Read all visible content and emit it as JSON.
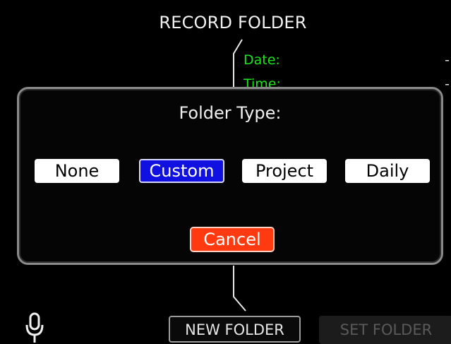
{
  "header": {
    "title": "RECORD FOLDER"
  },
  "info": {
    "date_label": "Date:",
    "time_label": "Time:"
  },
  "dialog": {
    "title": "Folder Type:",
    "options": [
      {
        "label": "None",
        "selected": false
      },
      {
        "label": "Custom",
        "selected": true
      },
      {
        "label": "Project",
        "selected": false
      },
      {
        "label": "Daily",
        "selected": false
      }
    ],
    "cancel_label": "Cancel"
  },
  "bottom_bar": {
    "mic_icon": "microphone-icon",
    "new_folder_label": "NEW FOLDER",
    "set_folder_label": "SET FOLDER",
    "set_folder_enabled": false
  },
  "colors": {
    "info_text": "#19e619",
    "selected_option": "#1010e0",
    "cancel_button": "#ff3a10"
  }
}
